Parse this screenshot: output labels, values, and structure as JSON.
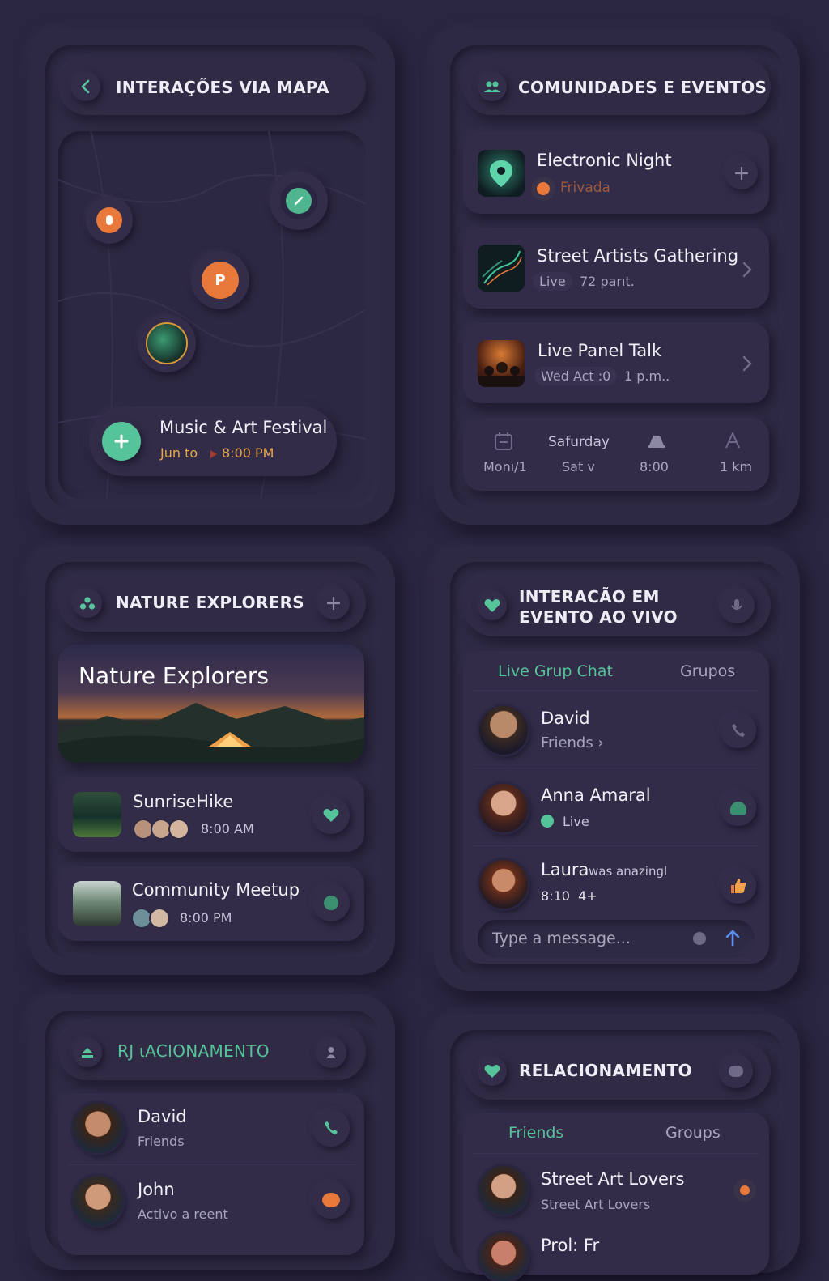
{
  "map_panel": {
    "title": "INTERAÇÕES VIA MAPA",
    "event": {
      "name": "Music & Art Festival",
      "date": "Jun to",
      "time": "8:00 PM"
    }
  },
  "communities_panel": {
    "title": "COMUNIDADES E EVENTOS",
    "items": [
      {
        "name": "Electronic Night",
        "status": "Frivada"
      },
      {
        "name": "Street Artists Gathering",
        "status": "Live",
        "extra": "72 parıt."
      },
      {
        "name": "Live Panel Talk",
        "status": "Wed Act :0",
        "extra": "1 p.m.."
      }
    ],
    "bar": {
      "col1": {
        "value": "Monı/1"
      },
      "col2": {
        "label": "Safurday",
        "value": "Sat v"
      },
      "col3": {
        "value": "8:00"
      },
      "col4": {
        "value": "1 km"
      }
    }
  },
  "nature_panel": {
    "title": "NATURE EXPLORERS",
    "banner_title": "Nature Explorers",
    "items": [
      {
        "name": "SunriseHike",
        "time": "8:00 AM"
      },
      {
        "name": "Community Meetup",
        "time": "8:00 PM"
      }
    ]
  },
  "live_panel": {
    "title_line1": "INTERACÃO EM",
    "title_line2": "EVENTO AO VIVO",
    "tabs": [
      "Live Grup Chat",
      "Grupos"
    ],
    "chats": [
      {
        "name": "David",
        "sub": "Friends ›"
      },
      {
        "name": "Anna Amaral",
        "sub": "Live"
      },
      {
        "name": "Laura",
        "note": "was anazingl",
        "sub": "8:10  4+"
      }
    ],
    "input_placeholder": "Type a message..."
  },
  "relation_panel_left": {
    "title": "RJ ιACIONAMENTO",
    "items": [
      {
        "name": "David",
        "sub": "Friends"
      },
      {
        "name": "John",
        "sub": "Activo a reent"
      }
    ]
  },
  "relation_panel_right": {
    "title": "RELACIONAMENTO",
    "tabs": [
      "Friends",
      "Groups"
    ],
    "items": [
      {
        "name": "Street Art Lovers",
        "sub": "Street Art Lovers"
      },
      {
        "name": "Prol: Fr",
        "sub": ""
      }
    ]
  },
  "colors": {
    "accent_green": "#56c49a",
    "accent_orange": "#e8793a",
    "background": "#2b2640",
    "text_orange": "#e8a84a"
  }
}
